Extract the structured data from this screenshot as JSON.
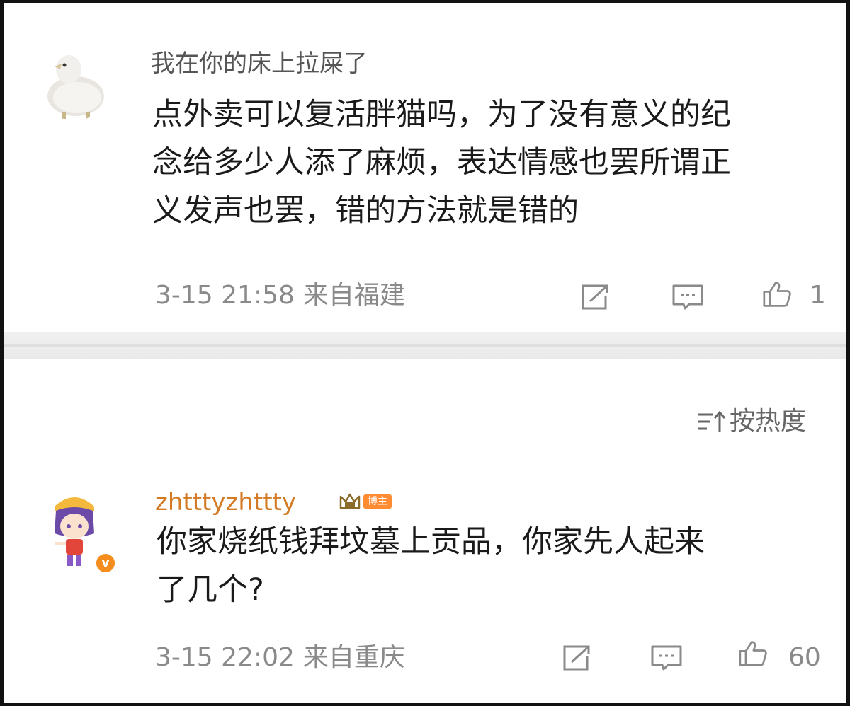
{
  "comments": [
    {
      "username": "我在你的床上拉屎了",
      "content_lines": [
        "点外卖可以复活胖猫吗，为了没有意义的纪",
        "念给多少人添了麻烦，表达情感也罢所谓正",
        "义发声也罢，错的方法就是错的"
      ],
      "date": "3-15 21:58",
      "location": "来自福建",
      "likes": "1",
      "avatar_icon": "duck-avatar"
    },
    {
      "username": "zhtttyzhttty",
      "badge_label": "博主",
      "verified_mark": "v",
      "content_lines": [
        "你家烧纸钱拜坟墓上贡品，你家先人起来",
        "了几个?"
      ],
      "date": "3-15 22:02",
      "location": "来自重庆",
      "likes": "60",
      "avatar_icon": "anime-avatar"
    }
  ],
  "sort": {
    "label": "按热度"
  },
  "colors": {
    "username_gray": "#555555",
    "username_orange": "#d47a25",
    "meta_gray": "#8a8a8a",
    "badge_orange": "#ff8b33"
  }
}
